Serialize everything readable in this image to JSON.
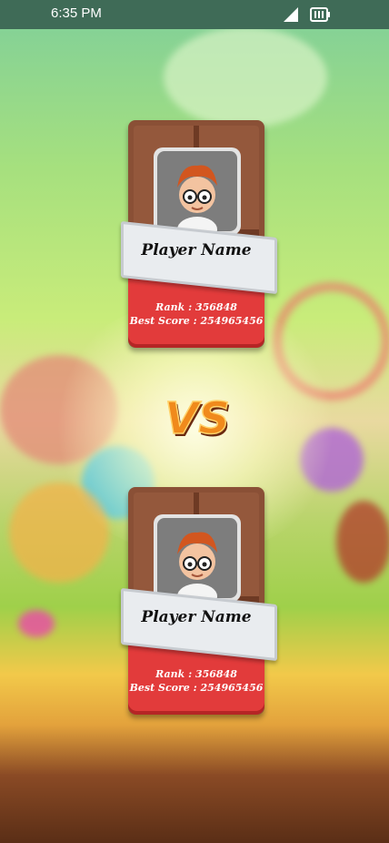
{
  "status_bar": {
    "time": "6:35 PM"
  },
  "vs_label": "VS",
  "players": [
    {
      "name": "Player Name",
      "rank": "Rank : 356848",
      "best_score": "Best Score : 254965456"
    },
    {
      "name": "Player Name",
      "rank": "Rank : 356848",
      "best_score": "Best Score : 254965456"
    }
  ],
  "colors": {
    "status_bar": "#3f6b57",
    "card_red": "#e23b3b",
    "chocolate": "#8a5036",
    "vs_orange": "#f08a1c"
  }
}
